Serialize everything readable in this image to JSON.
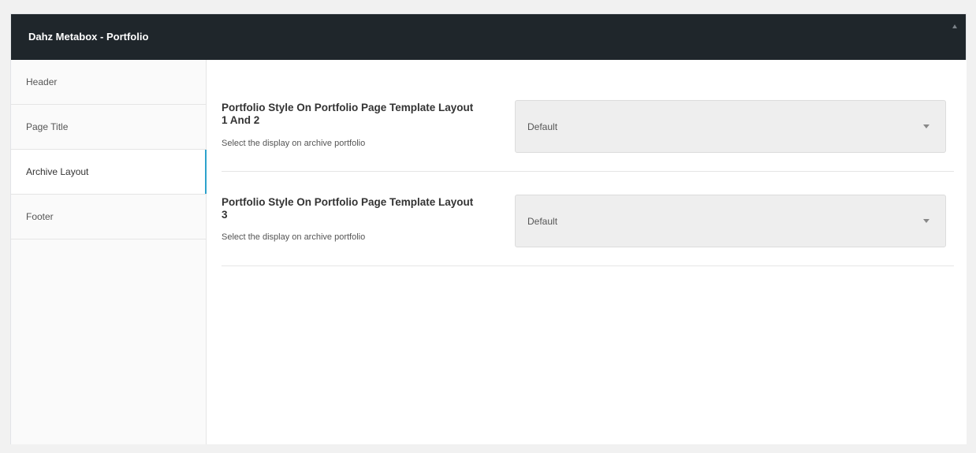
{
  "metabox": {
    "title": "Dahz Metabox - Portfolio"
  },
  "sidebar": {
    "items": [
      {
        "label": "Header"
      },
      {
        "label": "Page Title"
      },
      {
        "label": "Archive Layout"
      },
      {
        "label": "Footer"
      }
    ],
    "active": "Archive Layout"
  },
  "fields": [
    {
      "title": "Portfolio Style On Portfolio Page Template Layout 1 And 2",
      "description": "Select the display on archive portfolio",
      "value": "Default"
    },
    {
      "title": "Portfolio Style On Portfolio Page Template Layout 3",
      "description": "Select the display on archive portfolio",
      "value": "Default"
    }
  ],
  "colors": {
    "header_bg": "#1f262b",
    "active_accent": "#2ea2cc",
    "select_bg": "#eeeeee"
  },
  "icons": {
    "collapse": "caret-up-icon",
    "select_arrow": "caret-down-icon"
  }
}
